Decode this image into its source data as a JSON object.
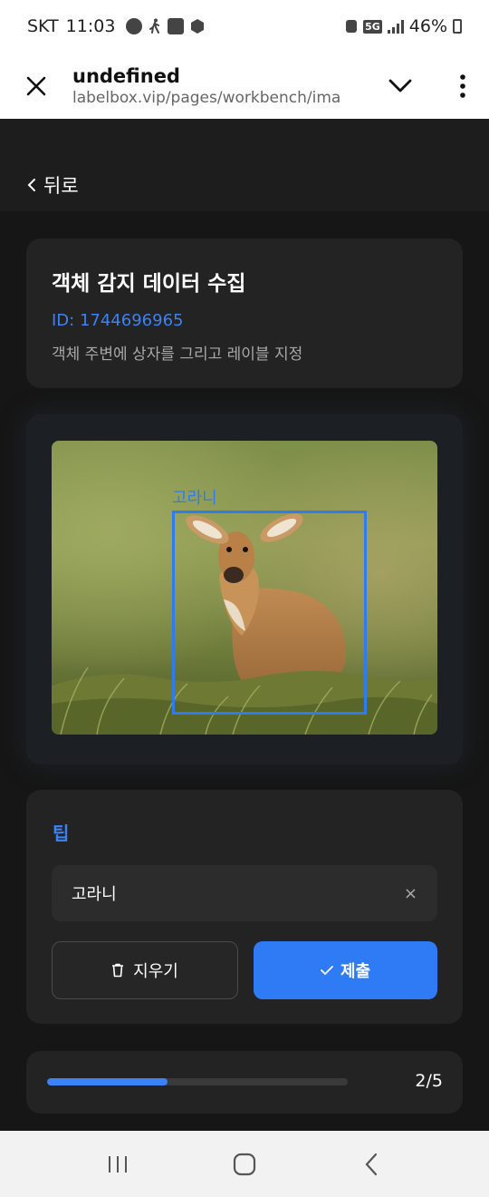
{
  "status_bar": {
    "carrier": "SKT",
    "time": "11:03",
    "network": "5G",
    "battery": "46%",
    "notification_icons": [
      "talk-icon",
      "walk-icon",
      "image-icon",
      "box-icon"
    ]
  },
  "browser": {
    "page_title": "undefined",
    "url": "labelbox.vip/pages/workbench/ima"
  },
  "header": {
    "back_label": "뒤로"
  },
  "task": {
    "title": "객체 감지 데이터 수집",
    "id_text": "ID: 1744696965",
    "description": "객체 주변에 상자를 그리고 레이블 지정"
  },
  "image": {
    "subject": "deer-in-grass",
    "bbox_label": "고라니"
  },
  "tip": {
    "title": "팁",
    "label_value": "고라니",
    "clear_icon": "×",
    "erase_button": "지우기",
    "submit_button": "제출"
  },
  "progress": {
    "current": 2,
    "total": 5,
    "text": "2/5",
    "fraction": 0.4
  },
  "colors": {
    "accent": "#2f7bf6",
    "background": "#161616",
    "card": "#232323"
  }
}
